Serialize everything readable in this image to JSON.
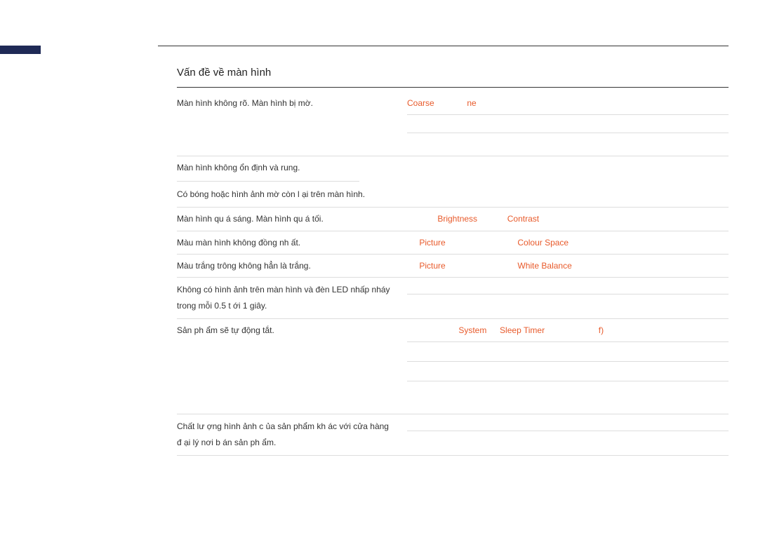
{
  "section_title": "Vấn đề về màn hình",
  "rows": {
    "r1": {
      "left": "Màn hình không rõ. Màn hình bị mờ.",
      "right_plain_a": "",
      "hl1": "Coarse",
      "mid": "",
      "hl2": "ne",
      "right_plain_b": ""
    },
    "r2": {
      "left": "Màn hình không ổn định và rung.",
      "right": ""
    },
    "r2b": {
      "left": "Có bóng hoặc hình ảnh mờ còn l ại trên màn hình.",
      "right": ""
    },
    "r3": {
      "left": "Màn hình qu á sáng. Màn hình qu á tối.",
      "right_plain_a": "",
      "hl1": "Brightness",
      "mid": "",
      "hl2": "Contrast",
      "right_plain_b": ""
    },
    "r4": {
      "left": "Màu màn hình không đồng nh ất.",
      "right_plain_a": "",
      "hl1": "Picture",
      "mid": "",
      "hl2": "Colour Space",
      "right_plain_b": ""
    },
    "r5": {
      "left": "Màu trắng trông không hẳn là trắng.",
      "right_plain_a": "",
      "hl1": "Picture",
      "mid": "",
      "hl2": "White Balance",
      "right_plain_b": ""
    },
    "r6": {
      "left": "Không có hình ảnh trên màn hình và đèn LED nhấp nháy trong mỗi 0.5 t ới 1 giây.",
      "right": ""
    },
    "r7": {
      "left": "Sản ph ẩm sẽ tự động tắt.",
      "right_plain_a": "",
      "hl1": "System",
      "mid": "",
      "hl2": "Sleep Timer",
      "right_plain_b": "",
      "hl3": "f)",
      "tail": ""
    },
    "r8": {
      "left": "Chất lư ợng hình ảnh c ủa sản phẩm kh ác với cửa hàng đ ại lý nơi b án sản ph ẩm.",
      "right": ""
    }
  }
}
